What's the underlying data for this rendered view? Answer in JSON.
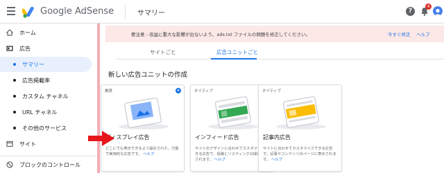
{
  "header": {
    "brand": "Google AdSense",
    "page_title": "サマリー",
    "help_icon": "?",
    "notification_count": "4",
    "icons": [
      "menu-icon",
      "adsense-logo",
      "help-icon",
      "bell-icon",
      "avatar"
    ]
  },
  "sidebar": {
    "items": [
      {
        "label": "ホーム",
        "icon": "home-icon"
      },
      {
        "label": "広告",
        "icon": "ads-icon"
      },
      {
        "label": "サマリー",
        "active": true
      },
      {
        "label": "広告掲載率"
      },
      {
        "label": "カスタム チャネル"
      },
      {
        "label": "URL チャネル"
      },
      {
        "label": "その他のサービス"
      },
      {
        "label": "サイト",
        "icon": "sites-icon"
      },
      {
        "label": "ブロックのコントロール",
        "icon": "block-icon"
      }
    ]
  },
  "alert": {
    "message": "要注意 - 収益に重大な影響が出ないよう、ads.txt ファイルの問題を修正してください。",
    "fix_label": "今すぐ修正",
    "help_label": "ヘルプ"
  },
  "tabs": [
    {
      "label": "サイトごと"
    },
    {
      "label": "広告ユニットごと",
      "active": true
    }
  ],
  "section_title": "新しい広告ユニットの作成",
  "cards": [
    {
      "badge": "推奨",
      "title": "ディスプレイ広告",
      "desc": "どこにでも表示できるよう設計された、万能で実用的な広告です。",
      "link": "ヘルプ"
    },
    {
      "badge": "ネイティブ",
      "title": "インフィード広告",
      "desc": "サイトのデザインに合わせてカスタマイズできる広告で、投稿とリスティングの間に表示されます。",
      "link": "ヘルプ"
    },
    {
      "badge": "ネイティブ",
      "title": "記事内広告",
      "desc": "サイトに合わせてカスタマイズできる広告で、記事やコンテンツのページに表示されます。",
      "link": "ヘルプ"
    }
  ],
  "colors": {
    "accent": "#1a73e8",
    "alert_bg": "#fce8e6",
    "arrow": "#e8141b"
  }
}
